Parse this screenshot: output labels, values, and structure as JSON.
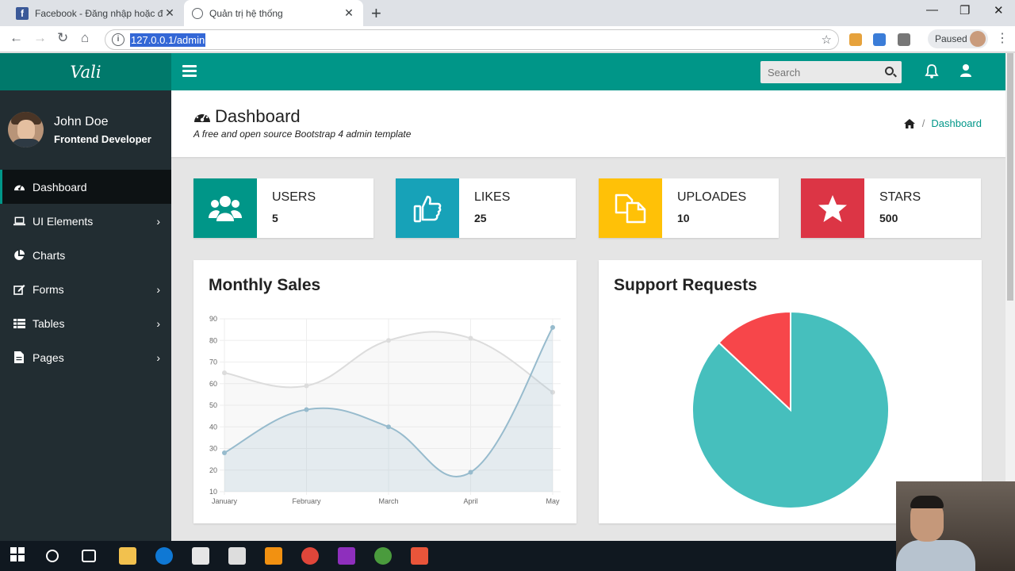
{
  "browser": {
    "tabs": [
      {
        "title": "Facebook - Đăng nhập hoặc đăng ký"
      },
      {
        "title": "Quản trị hệ thống"
      }
    ],
    "url": "127.0.0.1/admin",
    "profile_status": "Paused"
  },
  "app": {
    "logo": "Vali",
    "search_placeholder": "Search",
    "user": {
      "name": "John Doe",
      "role": "Frontend Developer"
    },
    "menu": [
      {
        "label": "Dashboard",
        "icon": "dashboard-icon",
        "active": true,
        "has_children": false
      },
      {
        "label": "UI Elements",
        "icon": "laptop-icon",
        "active": false,
        "has_children": true
      },
      {
        "label": "Charts",
        "icon": "pie-chart-icon",
        "active": false,
        "has_children": false
      },
      {
        "label": "Forms",
        "icon": "edit-icon",
        "active": false,
        "has_children": true
      },
      {
        "label": "Tables",
        "icon": "table-icon",
        "active": false,
        "has_children": true
      },
      {
        "label": "Pages",
        "icon": "file-icon",
        "active": false,
        "has_children": true
      }
    ],
    "page": {
      "title": "Dashboard",
      "subtitle": "A free and open source Bootstrap 4 admin template",
      "breadcrumb": "Dashboard"
    },
    "widgets": [
      {
        "label": "USERS",
        "value": "5",
        "color": "#009688",
        "icon": "users-icon"
      },
      {
        "label": "LIKES",
        "value": "25",
        "color": "#17a2b8",
        "icon": "thumbs-up-icon"
      },
      {
        "label": "UPLOADES",
        "value": "10",
        "color": "#ffc107",
        "icon": "files-icon"
      },
      {
        "label": "STARS",
        "value": "500",
        "color": "#dc3545",
        "icon": "star-icon"
      }
    ],
    "cards": {
      "sales_title": "Monthly Sales",
      "support_title": "Support Requests"
    }
  },
  "chart_data": [
    {
      "type": "line",
      "title": "Monthly Sales",
      "categories": [
        "January",
        "February",
        "March",
        "April",
        "May"
      ],
      "ylim": [
        10,
        90
      ],
      "yticks": [
        90,
        80,
        70,
        60,
        50,
        40,
        30,
        20,
        10
      ],
      "grid": true,
      "series": [
        {
          "values": [
            65,
            59,
            80,
            81,
            56
          ],
          "color": "#dcdcdc"
        },
        {
          "values": [
            28,
            48,
            40,
            19,
            86
          ],
          "color": "#97bbcd"
        }
      ]
    },
    {
      "type": "pie",
      "title": "Support Requests",
      "values": [
        87,
        13
      ],
      "colors": [
        "#46bfbd",
        "#f7464a"
      ]
    }
  ]
}
